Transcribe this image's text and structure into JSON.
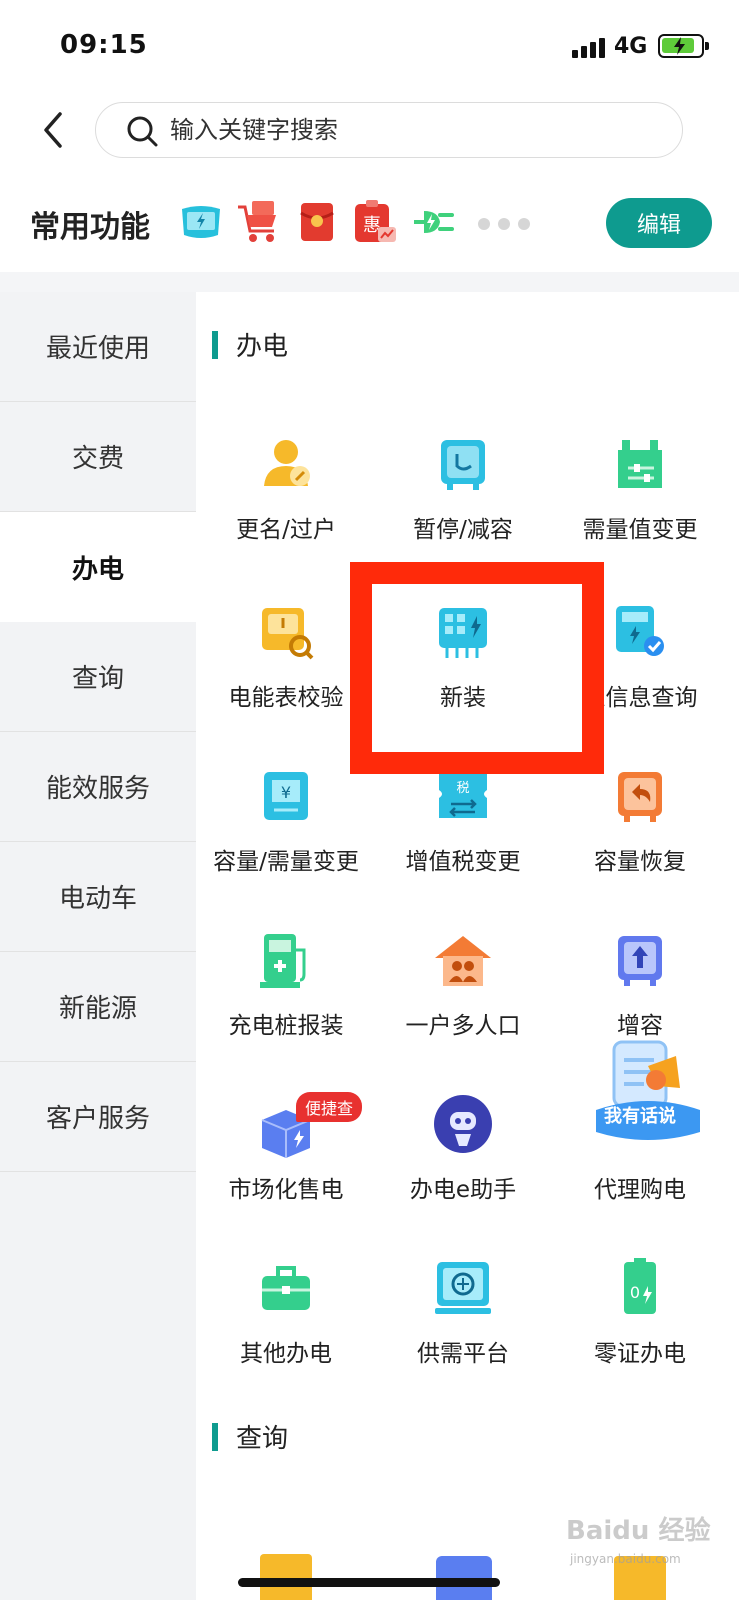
{
  "status_bar": {
    "time": "09:15",
    "network": "4G"
  },
  "search": {
    "placeholder": "输入关键字搜索"
  },
  "common": {
    "title": "常用功能",
    "edit_label": "编辑",
    "icons": [
      "tablet-bolt-icon",
      "cart-icon",
      "red-envelope-icon",
      "discount-coupon-icon",
      "plug-icon"
    ]
  },
  "sidebar": {
    "items": [
      "最近使用",
      "交费",
      "办电",
      "查询",
      "能效服务",
      "电动车",
      "新能源",
      "客户服务"
    ],
    "active_index": 2
  },
  "sections": {
    "electricity": "办电",
    "query": "查询"
  },
  "grid": [
    {
      "label": "更名/过户",
      "icon": "user-edit-icon"
    },
    {
      "label": "暂停/减容",
      "icon": "meter-pause-icon"
    },
    {
      "label": "需量值变更",
      "icon": "factory-slider-icon"
    },
    {
      "label": "电能表校验",
      "icon": "meter-inspect-icon"
    },
    {
      "label": "新装",
      "icon": "meter-bolt-icon"
    },
    {
      "label": "表信息查询",
      "icon": "meter-check-icon"
    },
    {
      "label": "容量/需量变更",
      "icon": "yuan-swap-icon"
    },
    {
      "label": "增值税变更",
      "icon": "tax-ticket-icon"
    },
    {
      "label": "容量恢复",
      "icon": "restore-arrow-icon"
    },
    {
      "label": "充电桩报装",
      "icon": "charging-pile-icon"
    },
    {
      "label": "一户多人口",
      "icon": "house-family-icon"
    },
    {
      "label": "增容",
      "icon": "capacity-up-icon"
    },
    {
      "label": "市场化售电",
      "icon": "market-box-icon",
      "badge": "便捷查"
    },
    {
      "label": "办电e助手",
      "icon": "robot-assistant-icon"
    },
    {
      "label": "代理购电",
      "icon": "speak-banner-icon",
      "banner": "我有话说"
    },
    {
      "label": "其他办电",
      "icon": "toolbox-icon"
    },
    {
      "label": "供需平台",
      "icon": "platform-screen-icon"
    },
    {
      "label": "零证办电",
      "icon": "zero-cert-icon"
    }
  ],
  "colors": {
    "accent": "#0e9b8f",
    "highlight": "#ff2a0a",
    "badge": "#e8312f"
  },
  "watermark": {
    "text": "Baidu 经验",
    "sub": "jingyan.baidu.com"
  }
}
